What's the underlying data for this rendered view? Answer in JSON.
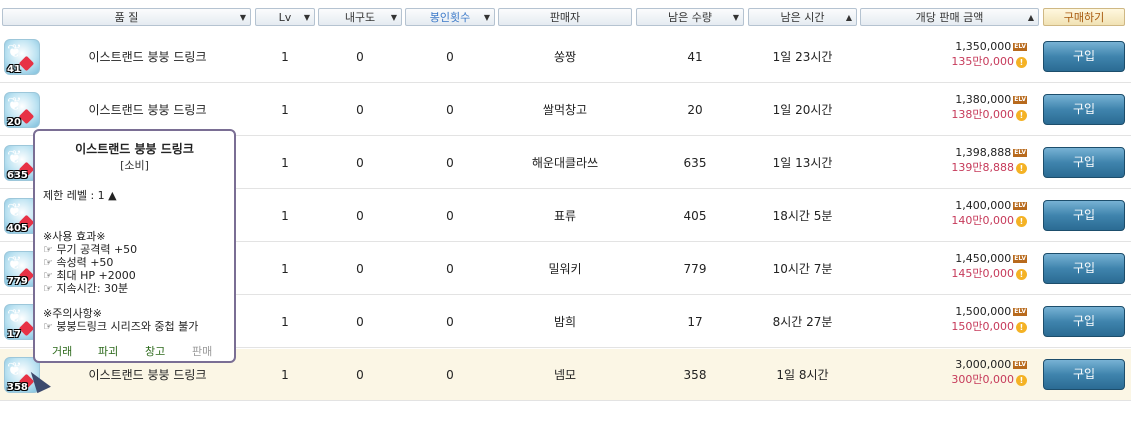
{
  "header": {
    "quality": "품 질",
    "lv": "Lv",
    "durability": "내구도",
    "seal_count": "봉인횟수",
    "seller": "판매자",
    "remaining_qty": "남은 수량",
    "remaining_time": "남은 시간",
    "unit_price": "개당 판매 금액",
    "buy": "구매하기"
  },
  "buy_label": "구입",
  "meso_unit": "ELV",
  "rows": [
    {
      "qty_badge": "41",
      "name": "이스트랜드 붕붕 드링크",
      "lv": "1",
      "dur": "0",
      "seal": "0",
      "seller": "쏭짱",
      "remaining": "41",
      "time": "1일 23시간",
      "price": "1,350,000",
      "man": "135만0,000"
    },
    {
      "qty_badge": "20",
      "name": "이스트랜드 붕붕 드링크",
      "lv": "1",
      "dur": "0",
      "seal": "0",
      "seller": "쌀먹창고",
      "remaining": "20",
      "time": "1일 20시간",
      "price": "1,380,000",
      "man": "138만0,000"
    },
    {
      "qty_badge": "635",
      "name": "",
      "lv": "1",
      "dur": "0",
      "seal": "0",
      "seller": "해운대클라쓰",
      "remaining": "635",
      "time": "1일 13시간",
      "price": "1,398,888",
      "man": "139만8,888"
    },
    {
      "qty_badge": "405",
      "name": "",
      "lv": "1",
      "dur": "0",
      "seal": "0",
      "seller": "표류",
      "remaining": "405",
      "time": "18시간 5분",
      "price": "1,400,000",
      "man": "140만0,000"
    },
    {
      "qty_badge": "779",
      "name": "",
      "lv": "1",
      "dur": "0",
      "seal": "0",
      "seller": "밀워키",
      "remaining": "779",
      "time": "10시간 7분",
      "price": "1,450,000",
      "man": "145만0,000"
    },
    {
      "qty_badge": "17",
      "name": "",
      "lv": "1",
      "dur": "0",
      "seal": "0",
      "seller": "밤희",
      "remaining": "17",
      "time": "8시간 27분",
      "price": "1,500,000",
      "man": "150만0,000"
    },
    {
      "qty_badge": "358",
      "name": "이스트랜드 붕붕 드링크",
      "lv": "1",
      "dur": "0",
      "seal": "0",
      "seller": "넴모",
      "remaining": "358",
      "time": "1일 8시간",
      "price": "3,000,000",
      "man": "300만0,000"
    }
  ],
  "tooltip": {
    "name": "이스트랜드 붕붕 드링크",
    "category": "[소비]",
    "req_level": "제한 레벨 : 1 ▲",
    "effect_title": "※사용 효과※",
    "effects": [
      "☞ 무기 공격력 +50",
      "☞ 속성력 +50",
      "☞ 최대 HP +2000",
      "☞ 지속시간: 30분"
    ],
    "caution_title": "※주의사항※",
    "caution": "☞ 붕붕드링크 시리즈와 중첩 불가",
    "actions": [
      "거래",
      "파괴",
      "창고",
      "판매"
    ]
  }
}
